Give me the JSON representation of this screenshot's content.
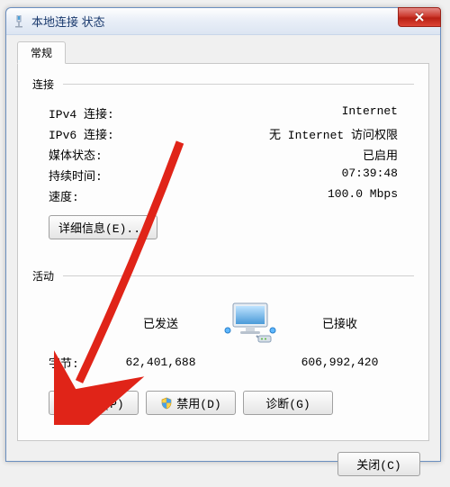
{
  "window": {
    "title": "本地连接 状态",
    "close_label": "X"
  },
  "tabs": [
    {
      "label": "常规"
    }
  ],
  "connection": {
    "group_title": "连接",
    "rows": [
      {
        "k": "IPv4 连接:",
        "v": "Internet"
      },
      {
        "k": "IPv6 连接:",
        "v": "无 Internet 访问权限"
      },
      {
        "k": "媒体状态:",
        "v": "已启用"
      },
      {
        "k": "持续时间:",
        "v": "07:39:48"
      },
      {
        "k": "速度:",
        "v": "100.0 Mbps"
      }
    ],
    "details_button": "详细信息(E)..."
  },
  "activity": {
    "group_title": "活动",
    "sent_label": "已发送",
    "received_label": "已接收",
    "bytes_label": "字节:",
    "sent_value": "62,401,688",
    "received_value": "606,992,420"
  },
  "buttons": {
    "properties": "属性(P)",
    "disable": "禁用(D)",
    "diagnose": "诊断(G)"
  },
  "footer": {
    "close": "关闭(C)"
  }
}
